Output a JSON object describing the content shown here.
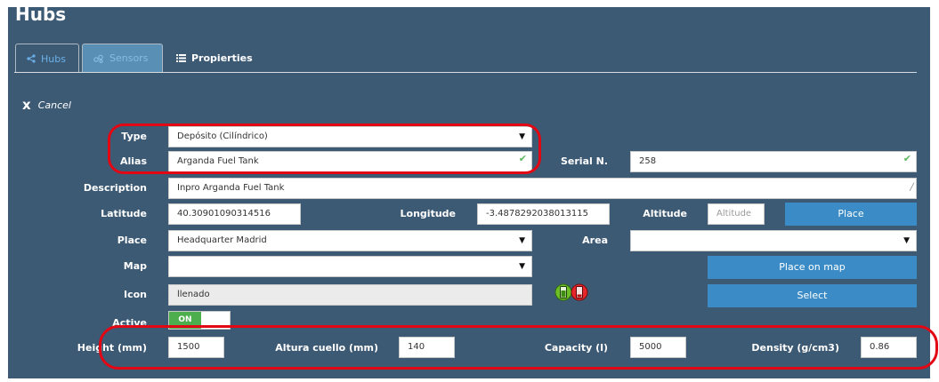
{
  "page": {
    "title": "Hubs"
  },
  "tabs": [
    {
      "label": "Hubs",
      "icon": "share-icon"
    },
    {
      "label": "Sensors",
      "icon": "sensors-icon"
    },
    {
      "label": "Propierties",
      "icon": "list-icon"
    }
  ],
  "cancel": {
    "label": "Cancel",
    "icon": "x"
  },
  "form": {
    "type": {
      "label": "Type",
      "value": "Depósito (Cilíndrico)"
    },
    "alias": {
      "label": "Alias",
      "value": "Arganda Fuel Tank"
    },
    "serial": {
      "label": "Serial N.",
      "value": "258"
    },
    "description": {
      "label": "Description",
      "value": "Inpro Arganda Fuel Tank"
    },
    "latitude": {
      "label": "Latitude",
      "value": "40.30901090314516"
    },
    "longitude": {
      "label": "Longitude",
      "value": "-3.4878292038013115"
    },
    "altitude": {
      "label": "Altitude",
      "placeholder": "Altitude"
    },
    "place_button": "Place",
    "place": {
      "label": "Place",
      "value": "Headquarter Madrid"
    },
    "area": {
      "label": "Area",
      "value": ""
    },
    "map": {
      "label": "Map",
      "value": ""
    },
    "place_on_map_button": "Place on map",
    "icon": {
      "label": "Icon",
      "value": "llenado"
    },
    "select_button": "Select",
    "active": {
      "label": "Active",
      "toggle": "ON"
    },
    "height": {
      "label": "Height (mm)",
      "value": "1500"
    },
    "neck_height": {
      "label": "Altura cuello (mm)",
      "value": "140"
    },
    "capacity": {
      "label": "Capacity (l)",
      "value": "5000"
    },
    "density": {
      "label": "Density (g/cm3)",
      "value": "0.86"
    }
  },
  "colors": {
    "panel": "#3d5a75",
    "button": "#3b8cc6",
    "highlight": "#e30613",
    "toggle_on": "#4cae4c"
  }
}
